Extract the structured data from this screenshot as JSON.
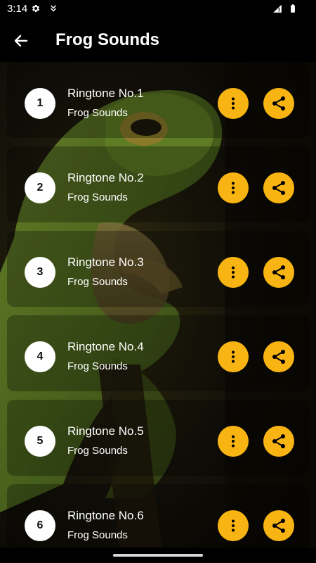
{
  "status_bar": {
    "time": "3:14",
    "icons": [
      "gear-icon",
      "download-icon",
      "wifi-icon",
      "battery-icon"
    ]
  },
  "app_bar": {
    "title": "Frog Sounds",
    "back_icon": "arrow-back-icon"
  },
  "colors": {
    "accent": "#f8b412",
    "background": "#000000",
    "text": "#ffffff"
  },
  "ringtones": [
    {
      "number": "1",
      "title": "Ringtone No.1",
      "subtitle": "Frog Sounds"
    },
    {
      "number": "2",
      "title": "Ringtone No.2",
      "subtitle": "Frog Sounds"
    },
    {
      "number": "3",
      "title": "Ringtone No.3",
      "subtitle": "Frog Sounds"
    },
    {
      "number": "4",
      "title": "Ringtone No.4",
      "subtitle": "Frog Sounds"
    },
    {
      "number": "5",
      "title": "Ringtone No.5",
      "subtitle": "Frog Sounds"
    },
    {
      "number": "6",
      "title": "Ringtone No.6",
      "subtitle": "Frog Sounds"
    }
  ],
  "row_actions": {
    "more_icon": "more-vertical-icon",
    "share_icon": "share-icon"
  }
}
